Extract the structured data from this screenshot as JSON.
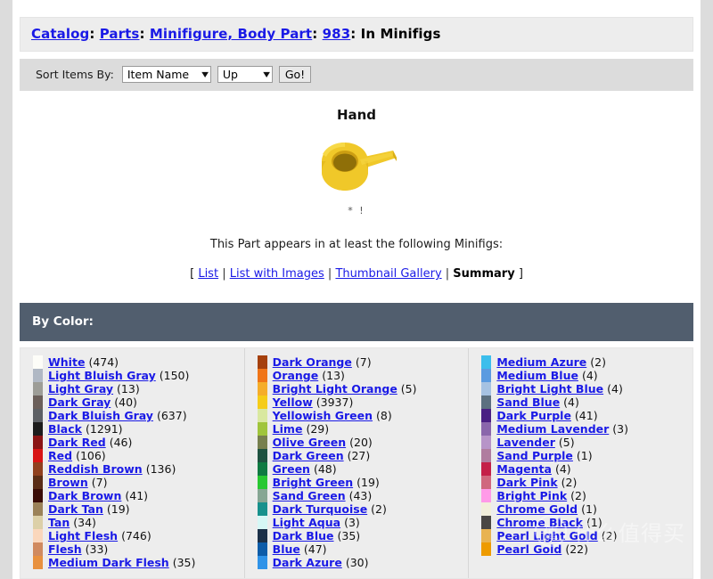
{
  "breadcrumb": {
    "items": [
      {
        "label": "Catalog",
        "link": true
      },
      {
        "label": "Parts",
        "link": true
      },
      {
        "label": "Minifigure, Body Part",
        "link": true
      },
      {
        "label": "983",
        "link": true
      },
      {
        "label": "In Minifigs",
        "link": false
      }
    ],
    "separator": ":"
  },
  "toolbar": {
    "sort_label": "Sort Items By:",
    "sort_field_value": "Item Name",
    "sort_dir_value": "Up",
    "go_label": "Go!",
    "arrow_glyph": "▼"
  },
  "part": {
    "title": "Hand",
    "flags": "* !",
    "image_alt": "yellow-minifigure-hand",
    "image_color": "#e8c020",
    "appears_text": "This Part appears in at least the following Minifigs:"
  },
  "view_links": {
    "open_bracket": "[",
    "close_bracket": "]",
    "separator": "|",
    "items": [
      {
        "label": "List",
        "active": false
      },
      {
        "label": "List with Images",
        "active": false
      },
      {
        "label": "Thumbnail Gallery",
        "active": false
      },
      {
        "label": "Summary",
        "active": true
      }
    ]
  },
  "by_color": {
    "heading": "By Color:",
    "header_bg": "#515e6e",
    "columns": [
      {
        "colors": [
          {
            "name": "White",
            "count": "(474)",
            "swatch": "#fdfdf8"
          },
          {
            "name": "Light Bluish Gray",
            "count": "(150)",
            "swatch": "#b0b8c4"
          },
          {
            "name": "Light Gray",
            "count": "(13)",
            "swatch": "#9d9d97"
          },
          {
            "name": "Dark Gray",
            "count": "(40)",
            "swatch": "#6b5f5a"
          },
          {
            "name": "Dark Bluish Gray",
            "count": "(637)",
            "swatch": "#5d6065"
          },
          {
            "name": "Black",
            "count": "(1291)",
            "swatch": "#1c1c1c"
          },
          {
            "name": "Dark Red",
            "count": "(46)",
            "swatch": "#8b1414"
          },
          {
            "name": "Red",
            "count": "(106)",
            "swatch": "#d81414"
          },
          {
            "name": "Reddish Brown",
            "count": "(136)",
            "swatch": "#90401e"
          },
          {
            "name": "Brown",
            "count": "(7)",
            "swatch": "#5a2d16"
          },
          {
            "name": "Dark Brown",
            "count": "(41)",
            "swatch": "#3a0d07"
          },
          {
            "name": "Dark Tan",
            "count": "(19)",
            "swatch": "#9b8259"
          },
          {
            "name": "Tan",
            "count": "(34)",
            "swatch": "#dcd0a8"
          },
          {
            "name": "Light Flesh",
            "count": "(746)",
            "swatch": "#fad7bc"
          },
          {
            "name": "Flesh",
            "count": "(33)",
            "swatch": "#d08a5f"
          },
          {
            "name": "Medium Dark Flesh",
            "count": "(35)",
            "swatch": "#e8913f"
          }
        ]
      },
      {
        "colors": [
          {
            "name": "Dark Orange",
            "count": "(7)",
            "swatch": "#a5400d"
          },
          {
            "name": "Orange",
            "count": "(13)",
            "swatch": "#f07518"
          },
          {
            "name": "Bright Light Orange",
            "count": "(5)",
            "swatch": "#f5ad2a"
          },
          {
            "name": "Yellow",
            "count": "(3937)",
            "swatch": "#f5cc18"
          },
          {
            "name": "Yellowish Green",
            "count": "(8)",
            "swatch": "#d9e8a0"
          },
          {
            "name": "Lime",
            "count": "(29)",
            "swatch": "#a0c53c"
          },
          {
            "name": "Olive Green",
            "count": "(20)",
            "swatch": "#77804e"
          },
          {
            "name": "Dark Green",
            "count": "(27)",
            "swatch": "#1e5240"
          },
          {
            "name": "Green",
            "count": "(48)",
            "swatch": "#0f7a42"
          },
          {
            "name": "Bright Green",
            "count": "(19)",
            "swatch": "#28c832"
          },
          {
            "name": "Sand Green",
            "count": "(43)",
            "swatch": "#86a693"
          },
          {
            "name": "Dark Turquoise",
            "count": "(2)",
            "swatch": "#17918c"
          },
          {
            "name": "Light Aqua",
            "count": "(3)",
            "swatch": "#d6f7f5"
          },
          {
            "name": "Dark Blue",
            "count": "(35)",
            "swatch": "#1b3048"
          },
          {
            "name": "Blue",
            "count": "(47)",
            "swatch": "#0d5ca8"
          },
          {
            "name": "Dark Azure",
            "count": "(30)",
            "swatch": "#2f93e8"
          }
        ]
      },
      {
        "colors": [
          {
            "name": "Medium Azure",
            "count": "(2)",
            "swatch": "#3cbeec"
          },
          {
            "name": "Medium Blue",
            "count": "(4)",
            "swatch": "#5b9be0"
          },
          {
            "name": "Bright Light Blue",
            "count": "(4)",
            "swatch": "#a6c2e2"
          },
          {
            "name": "Sand Blue",
            "count": "(4)",
            "swatch": "#5c7080"
          },
          {
            "name": "Dark Purple",
            "count": "(41)",
            "swatch": "#4a2083"
          },
          {
            "name": "Medium Lavender",
            "count": "(3)",
            "swatch": "#8a66ab"
          },
          {
            "name": "Lavender",
            "count": "(5)",
            "swatch": "#b794c8"
          },
          {
            "name": "Sand Purple",
            "count": "(1)",
            "swatch": "#b07d9f"
          },
          {
            "name": "Magenta",
            "count": "(4)",
            "swatch": "#c42048"
          },
          {
            "name": "Dark Pink",
            "count": "(2)",
            "swatch": "#d0687e"
          },
          {
            "name": "Bright Pink",
            "count": "(2)",
            "swatch": "#ff9ae8"
          },
          {
            "name": "Chrome Gold",
            "count": "(1)",
            "swatch": "#f2efdb"
          },
          {
            "name": "Chrome Black",
            "count": "(1)",
            "swatch": "#4a4744"
          },
          {
            "name": "Pearl Light Gold",
            "count": "(2)",
            "swatch": "#e8b351"
          },
          {
            "name": "Pearl Gold",
            "count": "(22)",
            "swatch": "#ee9b00"
          }
        ]
      }
    ]
  },
  "watermark": {
    "mark": "值",
    "text": "什么值得买"
  }
}
